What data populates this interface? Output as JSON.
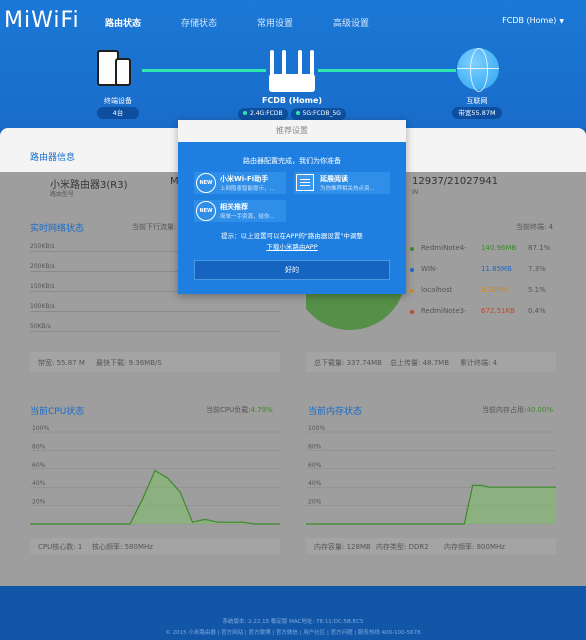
{
  "header": {
    "logo": "MiWiFi",
    "nav": [
      "路由状态",
      "存储状态",
      "常用设置",
      "高级设置"
    ],
    "user": "FCDB (Home)"
  },
  "topology": {
    "devices_label": "终端设备",
    "devices_count": "4台",
    "router_name": "FCDB (Home)",
    "band_24": "2.4G:FCDB",
    "band_5": "5G:FCDB_5G",
    "internet_label": "互联网",
    "internet_speed": "带宽55.87M"
  },
  "router_info": {
    "title": "路由器信息",
    "model": "小米路由器3(R3)",
    "model_label": "路由型号",
    "model_partial": "M",
    "traffic_value": "12937/21027941",
    "traffic_label": "IN"
  },
  "realtime": {
    "title": "实时网络状态",
    "current_upload": "当前下行流量:",
    "y_ticks": [
      "250KB/s",
      "200KB/s",
      "150KB/s",
      "100KB/s",
      "50KB/s"
    ],
    "bandwidth": "带宽: 55.87 M",
    "max_download": "最快下载: 9.36MB/S"
  },
  "terminals": {
    "count_label": "当前终端: 4",
    "items": [
      {
        "name": "RedmiNote4-",
        "value": "140.96MB",
        "pct": "87.1%",
        "color": "#3d8a2a"
      },
      {
        "name": "WIN-",
        "value": "11.85MB",
        "pct": "7.3%",
        "color": "#1e6ac8"
      },
      {
        "name": "localhost",
        "value": "8.28MB",
        "pct": "5.1%",
        "color": "#d08a1a"
      },
      {
        "name": "RedmiNote3-",
        "value": "672.51KB",
        "pct": "0.4%",
        "color": "#c04a2a"
      }
    ],
    "total_download": "总下载量: 337.74MB",
    "total_upload": "总上传量: 48.7MB",
    "cumulative": "累计终端: 4"
  },
  "cpu": {
    "title": "当前CPU状态",
    "load_label": "当前CPU负载:",
    "load_value": "4.79%",
    "y_ticks": [
      "100%",
      "80%",
      "60%",
      "40%",
      "20%"
    ],
    "cores": "CPU核心数: 1",
    "freq": "核心频率: 580MHz"
  },
  "memory": {
    "title": "当前内存状态",
    "usage_label": "当前内存占用:",
    "usage_value": "40.00%",
    "y_ticks": [
      "100%",
      "80%",
      "60%",
      "40%",
      "20%"
    ],
    "capacity": "内存容量: 128MB",
    "type": "内存类型: DDR2",
    "freq": "内存频率: 800MHz"
  },
  "modal": {
    "title": "推荐设置",
    "subtitle": "路由器配置完成，我们为你准备",
    "apps": [
      {
        "title": "小米Wi-Fi助手",
        "desc": "上网隐患智能提示，...",
        "badge": "NEW"
      },
      {
        "title": "延展阅读",
        "desc": "为你推荐相关热点资...",
        "badge": ""
      },
      {
        "title": "相关推荐",
        "desc": "简单一手资源，给你...",
        "badge": "NEW"
      }
    ],
    "tip": "提示：以上设置可以在APP的\"路由器设置\"中调整",
    "link": "下载小米路由APP",
    "button": "好的"
  },
  "footer": {
    "line1": "系统版本: 2.22.15 稳定版   MAC地址: 78:11:DC:5B:EC5",
    "line2": "© 2015 小米路由器 | 官方网站 | 官方微博 | 官方微信 | 用户社区 | 官方问题 | 服务热线 400-100-5678"
  },
  "chart_data": [
    {
      "type": "area",
      "title": "当前CPU状态",
      "y_ticks": [
        "100%",
        "80%",
        "60%",
        "40%",
        "20%"
      ],
      "ylim": [
        0,
        100
      ],
      "values": [
        0,
        0,
        0,
        0,
        0,
        0,
        0,
        0,
        0,
        27,
        58,
        50,
        35,
        2,
        5,
        2,
        2,
        2,
        0,
        0,
        0
      ]
    },
    {
      "type": "area",
      "title": "当前内存状态",
      "y_ticks": [
        "100%",
        "80%",
        "60%",
        "40%",
        "20%"
      ],
      "ylim": [
        0,
        100
      ],
      "values": [
        0,
        0,
        0,
        0,
        0,
        0,
        0,
        0,
        0,
        0,
        0,
        0,
        0,
        0,
        0,
        0,
        0,
        0,
        0,
        0,
        42,
        42,
        40,
        40,
        40,
        40,
        40,
        40,
        40,
        40,
        40
      ]
    },
    {
      "type": "pie",
      "title": "",
      "categories": [
        "RedmiNote4-",
        "WIN-",
        "localhost",
        "RedmiNote3-"
      ],
      "values": [
        87.1,
        7.3,
        5.1,
        0.4
      ]
    }
  ]
}
